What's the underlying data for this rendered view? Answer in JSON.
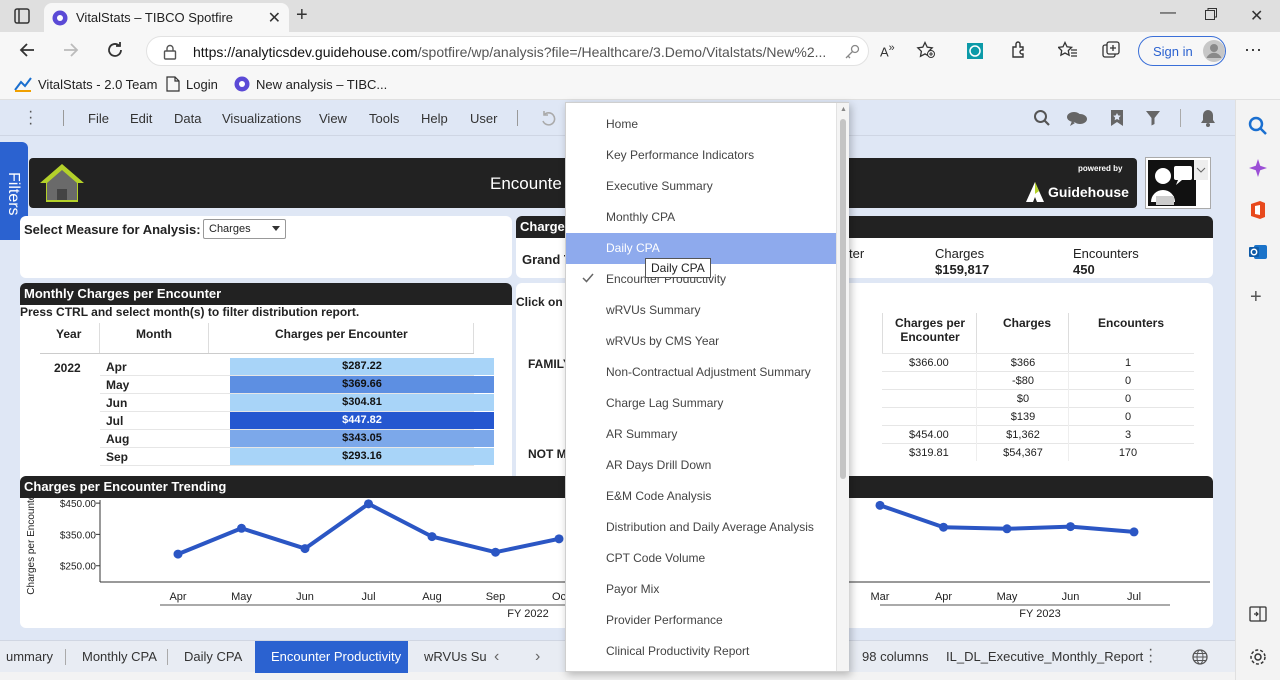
{
  "browser": {
    "tab_title": "VitalStats – TIBCO Spotfire",
    "url_host": "https://analyticsdev.guidehouse.com",
    "url_path": "/spotfire/wp/analysis?file=/Healthcare/3.Demo/Vitalstats/New%2...",
    "sign_in": "Sign in"
  },
  "favorites": [
    "VitalStats - 2.0 Team",
    "Login",
    "New analysis – TIBC..."
  ],
  "menu": [
    "File",
    "Edit",
    "Data",
    "Visualizations",
    "View",
    "Tools",
    "Help",
    "User"
  ],
  "filters_tab": "Filters",
  "header": {
    "title": "Encounte",
    "powered_by": "powered by",
    "brand": "Guidehouse"
  },
  "measure": {
    "label": "Select Measure for Analysis:",
    "value": "Charges"
  },
  "summary": {
    "head": "Charge",
    "grand": "Grand T",
    "frag": "ter",
    "charges_label": "Charges",
    "charges_value": "$159,817",
    "encounters_label": "Encounters",
    "encounters_value": "450"
  },
  "monthly": {
    "title": "Monthly Charges per Encounter",
    "instruction": "Press CTRL and select month(s) to filter distribution report.",
    "col_year": "Year",
    "col_month": "Month",
    "col_cpe": "Charges per Encounter",
    "year": "2022",
    "rows": [
      {
        "month": "Apr",
        "value": "$287.22",
        "amount": 287.22
      },
      {
        "month": "May",
        "value": "$369.66",
        "amount": 369.66
      },
      {
        "month": "Jun",
        "value": "$304.81",
        "amount": 304.81
      },
      {
        "month": "Jul",
        "value": "$447.82",
        "amount": 447.82
      },
      {
        "month": "Aug",
        "value": "$343.05",
        "amount": 343.05
      },
      {
        "month": "Sep",
        "value": "$293.16",
        "amount": 293.16
      }
    ]
  },
  "detail": {
    "click_on": "Click on",
    "col_cpe": "Charges per Encounter",
    "col_charges": "Charges",
    "col_encounters": "Encounters",
    "group1": "FAMILY",
    "group2": "NOT M",
    "rows": [
      {
        "cpe": "$366.00",
        "charges": "$366",
        "enc": "1"
      },
      {
        "cpe": "",
        "charges": "-$80",
        "enc": "0"
      },
      {
        "cpe": "",
        "charges": "$0",
        "enc": "0"
      },
      {
        "cpe": "",
        "charges": "$139",
        "enc": "0"
      },
      {
        "cpe": "$454.00",
        "charges": "$1,362",
        "enc": "3"
      },
      {
        "cpe": "$319.81",
        "charges": "$54,367",
        "enc": "170"
      }
    ]
  },
  "trend": {
    "title": "Charges per Encounter Trending"
  },
  "chart_data": {
    "type": "line",
    "ylabel": "Charges per Encounter",
    "yticks": [
      "$450.00",
      "$350.00",
      "$250.00"
    ],
    "ylim": [
      230,
      460
    ],
    "fy_labels": [
      "FY 2022",
      "FY 2023"
    ],
    "left": {
      "x": [
        "Apr",
        "May",
        "Jun",
        "Jul",
        "Aug",
        "Sep",
        "Oc"
      ],
      "values": [
        287.22,
        369.66,
        304.81,
        447.82,
        343.05,
        293.16,
        336
      ]
    },
    "right": {
      "x": [
        "Mar",
        "Apr",
        "May",
        "Jun",
        "Jul"
      ],
      "values": [
        443,
        373,
        368,
        375,
        358
      ]
    },
    "color": "#2b56c4"
  },
  "dropdown": {
    "items": [
      "Home",
      "Key Performance Indicators",
      "Executive Summary",
      "Monthly CPA",
      "Daily CPA",
      "Encounter Productivity",
      "wRVUs Summary",
      "wRVUs by CMS Year",
      "Non-Contractual Adjustment Summary",
      "Charge Lag Summary",
      "AR Summary",
      "AR Days Drill Down",
      "E&M Code Analysis",
      "Distribution and Daily Average Analysis",
      "CPT Code Volume",
      "Payor Mix",
      "Provider Performance",
      "Clinical Productivity Report"
    ],
    "highlighted": "Daily CPA",
    "checked": "Encounter Productivity",
    "tooltip": "Daily CPA"
  },
  "bottom_tabs": [
    "ummary",
    "Monthly CPA",
    "Daily CPA",
    "Encounter Productivity",
    "wRVUs Su"
  ],
  "active_tab": "Encounter Productivity",
  "status": {
    "columns": "98 columns",
    "table_name": "IL_DL_Executive_Monthly_Report"
  }
}
